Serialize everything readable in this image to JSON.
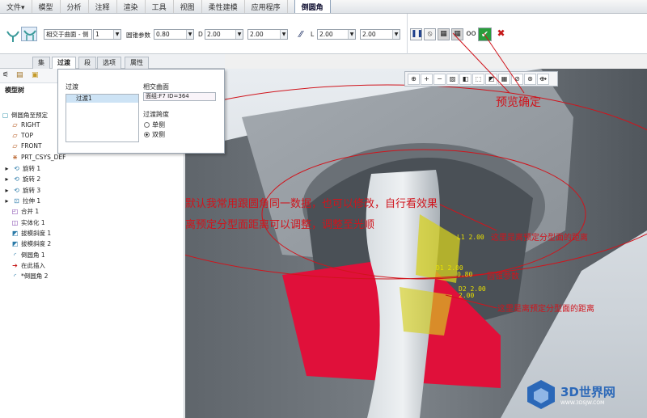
{
  "menu": {
    "tabs": [
      "文件▾",
      "模型",
      "分析",
      "注释",
      "渲染",
      "工具",
      "视图",
      "柔性建模",
      "应用程序",
      "倒圆角"
    ],
    "active_tab": "倒圆角"
  },
  "ribbon": {
    "mode_value": "相交于曲面 - 侧",
    "mode_count": "1",
    "conic_label": "圆锥参数",
    "conic_value": "0.80",
    "d_label": "D",
    "d_value1": "2.00",
    "d_value2": "2.00",
    "l_label": "L",
    "l_value1": "2.00",
    "l_value2": "2.00"
  },
  "subtabs": [
    "集",
    "过渡",
    "段",
    "选项",
    "属性"
  ],
  "active_subtab": "过渡",
  "transition_panel": {
    "header": "过渡",
    "selected_item": "过渡1",
    "intersect_label": "相交曲面",
    "intersect_value": "面组:F7 ID=364",
    "span_label": "过渡跨度",
    "option1": "单侧",
    "option2": "双侧"
  },
  "tree": {
    "title": "模型树",
    "items": [
      {
        "label": "倒圆角至预定",
        "icon": "part-icon"
      },
      {
        "label": "RIGHT",
        "icon": "datum-plane-icon"
      },
      {
        "label": "TOP",
        "icon": "datum-plane-icon"
      },
      {
        "label": "FRONT",
        "icon": "datum-plane-icon"
      },
      {
        "label": "PRT_CSYS_DEF",
        "icon": "csys-icon"
      },
      {
        "label": "旋转 1",
        "icon": "revolve-icon"
      },
      {
        "label": "旋转 2",
        "icon": "revolve-icon"
      },
      {
        "label": "旋转 3",
        "icon": "revolve-icon"
      },
      {
        "label": "拉伸 1",
        "icon": "extrude-icon"
      },
      {
        "label": "合并 1",
        "icon": "merge-icon"
      },
      {
        "label": "实体化 1",
        "icon": "solidify-icon"
      },
      {
        "label": "拔模斜度 1",
        "icon": "draft-icon"
      },
      {
        "label": "拔模斜度 2",
        "icon": "draft-icon"
      },
      {
        "label": "倒圆角 1",
        "icon": "round-icon"
      },
      {
        "label": "在此插入",
        "icon": "insert-here-icon"
      },
      {
        "label": "*倒圆角 2",
        "icon": "round-icon"
      }
    ]
  },
  "annotations": {
    "preview_confirm": "预览确定",
    "line1": "默认我常用跟圆角同一数据，也可以修改，自行看效果",
    "line2": "离预定分型面距离可以调整，调整至光顺",
    "dist_note1": "这里是离预定分型面的距离",
    "conic_note": "圆锥参数",
    "dist_note2": "这里是离预定分型面的距离"
  },
  "dims": {
    "l1": "L1 2.00",
    "d1": "D1 2.00",
    "conic_a": "0.80",
    "d2": "D2 2.00",
    "l2": "2.00"
  },
  "watermark": {
    "brand": "3D世界网",
    "url": "WWW.3DSJW.COM"
  },
  "colors": {
    "accent_red": "#d0141c",
    "fillet_red": "#e0103a",
    "selected_yellow": "#e8e000"
  }
}
